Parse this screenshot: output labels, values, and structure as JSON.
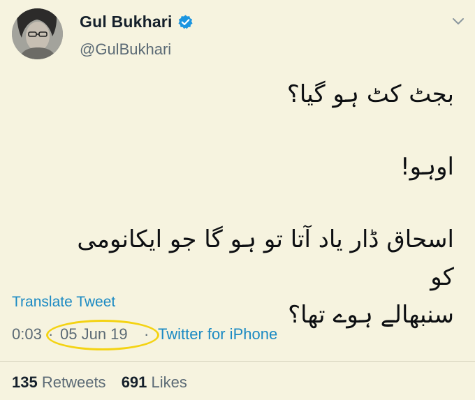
{
  "author": {
    "display_name": "Gul Bukhari",
    "handle": "@GulBukhari",
    "verified": true,
    "avatar_icon": "avatar-photo",
    "verified_icon": "verified-badge-icon"
  },
  "tweet": {
    "lines": [
      "بجٹ کٹ ہو گیا؟",
      "اوہو!",
      "اسحاق ڈار یاد آتا تو ہو گا جو ایکانومی کو",
      "سنبھالے ہوے تھا؟"
    ]
  },
  "actions": {
    "translate_label": "Translate Tweet",
    "menu_icon": "chevron-down-icon"
  },
  "meta": {
    "time": "0:03",
    "separator": "·",
    "date": "05 Jun 19",
    "source": "Twitter for iPhone"
  },
  "stats": {
    "retweets_count": "135",
    "retweets_label": "Retweets",
    "likes_count": "691",
    "likes_label": "Likes"
  },
  "colors": {
    "background": "#f6f3df",
    "link": "#1b8ac3",
    "muted": "#5b6a75",
    "highlight": "#f4d313",
    "verified": "#1b95e0"
  }
}
